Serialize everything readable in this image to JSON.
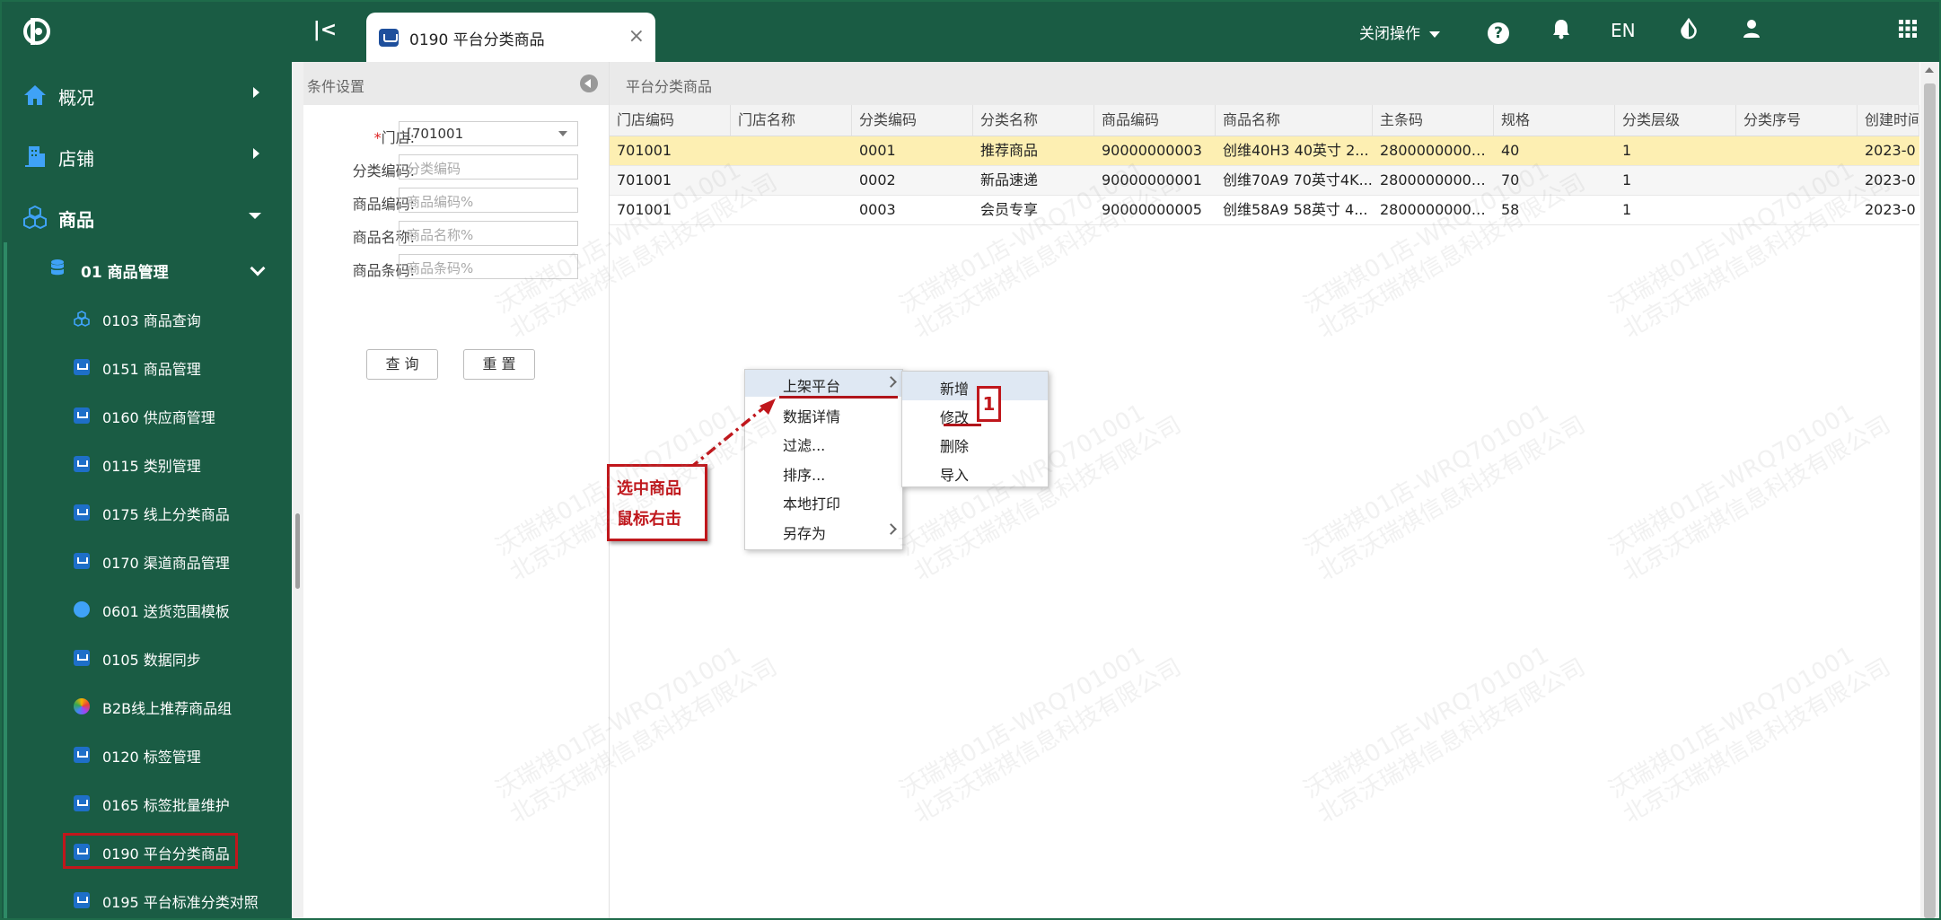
{
  "topbar": {
    "tab_label": "0190 平台分类商品",
    "close_menu_label": "关闭操作",
    "lang_label": "EN"
  },
  "sidebar": {
    "main_items": [
      {
        "label": "概况",
        "icon": "home-icon"
      },
      {
        "label": "店铺",
        "icon": "building-icon"
      },
      {
        "label": "商品",
        "icon": "cubes-icon"
      }
    ],
    "sub_group": {
      "label": "01 商品管理",
      "icon": "database-icon"
    },
    "leaf_items": [
      {
        "label": "0103 商品查询",
        "icon": "cubes-icon"
      },
      {
        "label": "0151 商品管理",
        "icon": "cart-icon"
      },
      {
        "label": "0160 供应商管理",
        "icon": "cart-icon"
      },
      {
        "label": "0115 类别管理",
        "icon": "cart-icon"
      },
      {
        "label": "0175 线上分类商品",
        "icon": "cart-icon"
      },
      {
        "label": "0170 渠道商品管理",
        "icon": "cart-icon"
      },
      {
        "label": "0601 送货范围模板",
        "icon": "globe-icon"
      },
      {
        "label": "0105 数据同步",
        "icon": "cart-icon"
      },
      {
        "label": "B2B线上推荐商品组",
        "icon": "flower-icon"
      },
      {
        "label": "0120 标签管理",
        "icon": "cart-icon"
      },
      {
        "label": "0165 标签批量维护",
        "icon": "cart-icon"
      },
      {
        "label": "0190 平台分类商品",
        "icon": "cart-icon"
      },
      {
        "label": "0195 平台标准分类对照",
        "icon": "cart-icon"
      }
    ]
  },
  "conditions": {
    "title": "条件设置",
    "fields": [
      {
        "label": "门店:",
        "required_mark": "*",
        "value": "[701001",
        "placeholder": ""
      },
      {
        "label": "分类编码:",
        "value": "",
        "placeholder": "分类编码"
      },
      {
        "label": "商品编码:",
        "value": "",
        "placeholder": "商品编码%"
      },
      {
        "label": "商品名称:",
        "value": "",
        "placeholder": "商品名称%"
      },
      {
        "label": "商品条码:",
        "value": "",
        "placeholder": "商品条码%"
      }
    ],
    "query_label": "查 询",
    "reset_label": "重 置"
  },
  "grid": {
    "title": "平台分类商品",
    "columns": [
      "门店编码",
      "门店名称",
      "分类编码",
      "分类名称",
      "商品编码",
      "商品名称",
      "主条码",
      "规格",
      "分类层级",
      "分类序号",
      "创建时间"
    ],
    "rows": [
      [
        "701001",
        "",
        "0001",
        "推荐商品",
        "90000000003",
        "创维40H3 40英寸 2...",
        "28000000000...",
        "40",
        "1",
        "",
        "2023-0"
      ],
      [
        "701001",
        "",
        "0002",
        "新品速递",
        "90000000001",
        "创维70A9 70英寸4K...",
        "28000000000...",
        "70",
        "1",
        "",
        "2023-0"
      ],
      [
        "701001",
        "",
        "0003",
        "会员专享",
        "90000000005",
        "创维58A9 58英寸 4...",
        "28000000000...",
        "58",
        "1",
        "",
        "2023-0"
      ]
    ]
  },
  "context_menu": {
    "items": [
      "上架平台",
      "数据详情",
      "过滤...",
      "排序...",
      "本地打印",
      "另存为"
    ],
    "submenu": [
      "新增",
      "修改",
      "删除",
      "导入"
    ],
    "badge": "1"
  },
  "callout": {
    "line1": "选中商品",
    "line2": "鼠标右击"
  },
  "watermark": {
    "line1": "沃瑞祺01店-WRQ701001",
    "line2": "北京沃瑞祺信息科技有限公司"
  },
  "colors": {
    "sidebar_bg": "#1a5c44",
    "highlight_red": "#c0171c",
    "selected_row": "#fdefb2"
  }
}
